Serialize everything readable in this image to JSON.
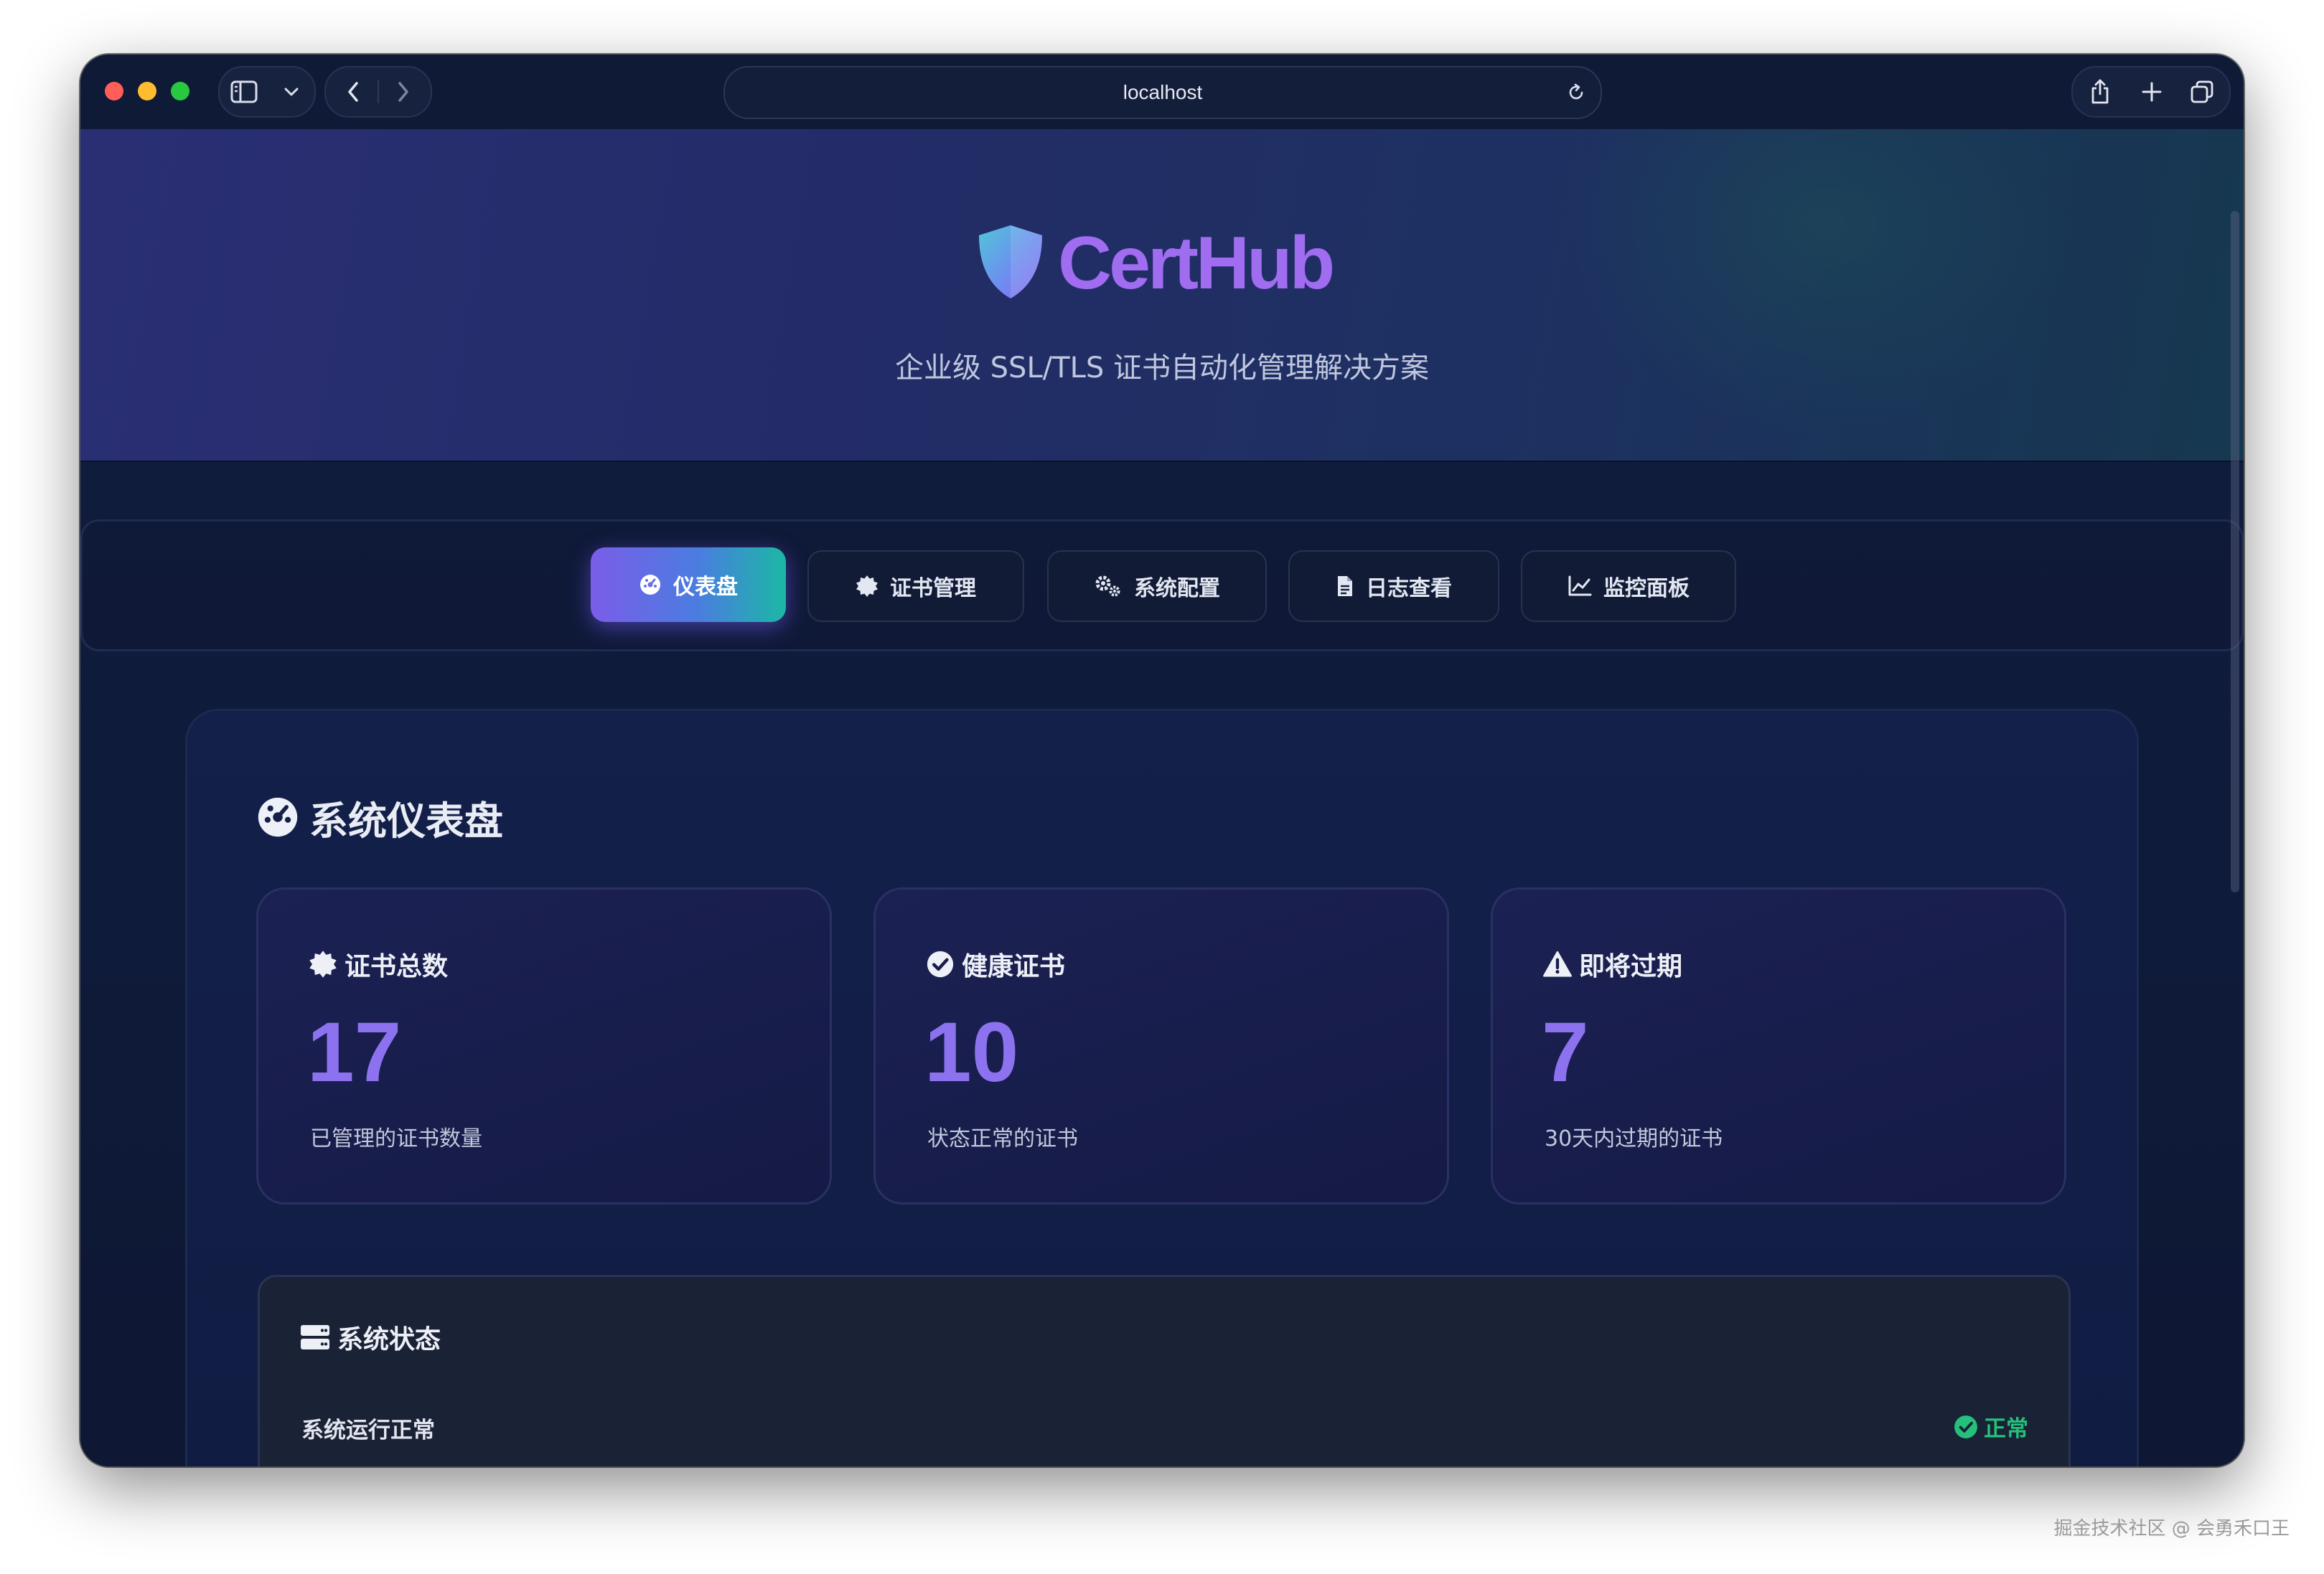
{
  "browser": {
    "url": "localhost",
    "traffic_lights": [
      "#ff5f57",
      "#febc2e",
      "#28c840"
    ]
  },
  "brand": {
    "name": "CertHub",
    "tagline": "企业级 SSL/TLS 证书自动化管理解决方案",
    "accent": "#a06cf0"
  },
  "nav": {
    "tabs": [
      {
        "label": "仪表盘",
        "icon": "dashboard-icon",
        "active": true
      },
      {
        "label": "证书管理",
        "icon": "certificate-icon",
        "active": false
      },
      {
        "label": "系统配置",
        "icon": "cogs-icon",
        "active": false
      },
      {
        "label": "日志查看",
        "icon": "file-icon",
        "active": false
      },
      {
        "label": "监控面板",
        "icon": "chart-line-icon",
        "active": false
      }
    ]
  },
  "dashboard": {
    "title": "系统仪表盘",
    "stats": [
      {
        "title": "证书总数",
        "value": "17",
        "desc": "已管理的证书数量",
        "icon": "certificate-icon"
      },
      {
        "title": "健康证书",
        "value": "10",
        "desc": "状态正常的证书",
        "icon": "check-circle-icon"
      },
      {
        "title": "即将过期",
        "value": "7",
        "desc": "30天内过期的证书",
        "icon": "warning-icon"
      }
    ],
    "system_status": {
      "title": "系统状态",
      "row_label": "系统运行正常",
      "badge": "正常",
      "badge_color": "#25c07b"
    }
  },
  "watermark": "掘金技术社区 @ 会勇禾口王"
}
